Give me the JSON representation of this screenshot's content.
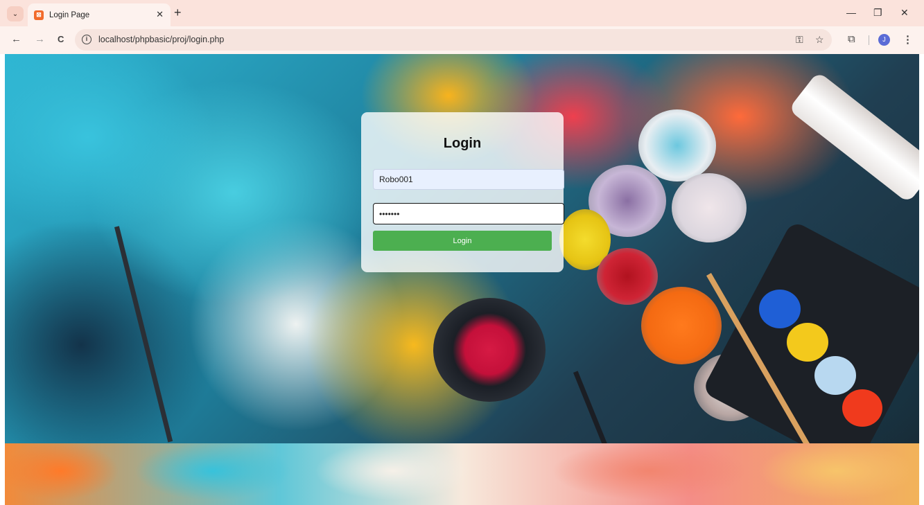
{
  "browser": {
    "tab": {
      "title": "Login Page",
      "favicon": "xampp-icon",
      "close_glyph": "✕"
    },
    "new_tab_glyph": "+",
    "tab_menu_glyph": "⌄",
    "window_controls": {
      "minimize": "—",
      "restore": "❐",
      "close": "✕"
    },
    "nav": {
      "back": "←",
      "forward": "→",
      "reload": "C"
    },
    "address": {
      "url": "localhost/phpbasic/proj/login.php",
      "info_glyph": "i"
    },
    "omnibox_icons": {
      "password_key": "⚿",
      "bookmark_star": "☆"
    },
    "extensions_glyph": "⧉",
    "profile_initial": "J",
    "menu_glyph": "⋮"
  },
  "login": {
    "title": "Login",
    "username_value": "Robo001",
    "password_value": "•••••••",
    "button_label": "Login"
  },
  "colors": {
    "accent_button": "#4caf50",
    "tab_strip": "#fbe3dc",
    "autofill_bg": "#e8f0fe"
  }
}
